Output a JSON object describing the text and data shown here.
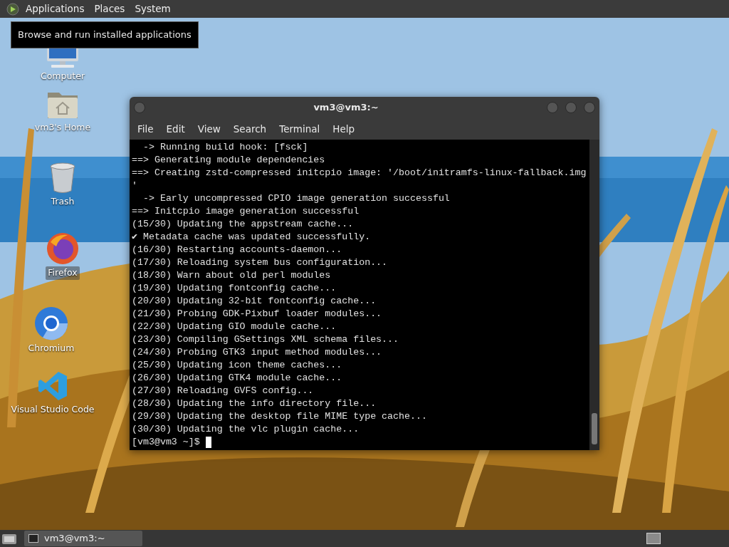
{
  "top_panel": {
    "menus": [
      {
        "label": "Applications"
      },
      {
        "label": "Places"
      },
      {
        "label": "System"
      }
    ]
  },
  "tooltip": {
    "text": "Browse and run installed applications"
  },
  "desktop_icons": [
    {
      "kind": "computer",
      "label": "Computer",
      "selected": false
    },
    {
      "kind": "home",
      "label": "vm3's Home",
      "selected": false
    },
    {
      "kind": "trash",
      "label": "Trash",
      "selected": false
    },
    {
      "kind": "firefox",
      "label": "Firefox",
      "selected": true
    },
    {
      "kind": "chromium",
      "label": "Chromium",
      "selected": false
    },
    {
      "kind": "vscode",
      "label": "Visual Studio Code",
      "selected": false
    }
  ],
  "terminal": {
    "title": "vm3@vm3:~",
    "menu": [
      "File",
      "Edit",
      "View",
      "Search",
      "Terminal",
      "Help"
    ],
    "lines": [
      "  -> Running build hook: [fsck]",
      "==> Generating module dependencies",
      "==> Creating zstd-compressed initcpio image: '/boot/initramfs-linux-fallback.img",
      "'",
      "  -> Early uncompressed CPIO image generation successful",
      "==> Initcpio image generation successful",
      "(15/30) Updating the appstream cache...",
      "✔ Metadata cache was updated successfully.",
      "(16/30) Restarting accounts-daemon...",
      "(17/30) Reloading system bus configuration...",
      "(18/30) Warn about old perl modules",
      "(19/30) Updating fontconfig cache...",
      "(20/30) Updating 32-bit fontconfig cache...",
      "(21/30) Probing GDK-Pixbuf loader modules...",
      "(22/30) Updating GIO module cache...",
      "(23/30) Compiling GSettings XML schema files...",
      "(24/30) Probing GTK3 input method modules...",
      "(25/30) Updating icon theme caches...",
      "(26/30) Updating GTK4 module cache...",
      "(27/30) Reloading GVFS config...",
      "(28/30) Updating the info directory file...",
      "(29/30) Updating the desktop file MIME type cache...",
      "(30/30) Updating the vlc plugin cache..."
    ],
    "prompt": "[vm3@vm3 ~]$"
  },
  "taskbar": {
    "tasks": [
      {
        "label": "vm3@vm3:~",
        "selected": true
      }
    ]
  }
}
